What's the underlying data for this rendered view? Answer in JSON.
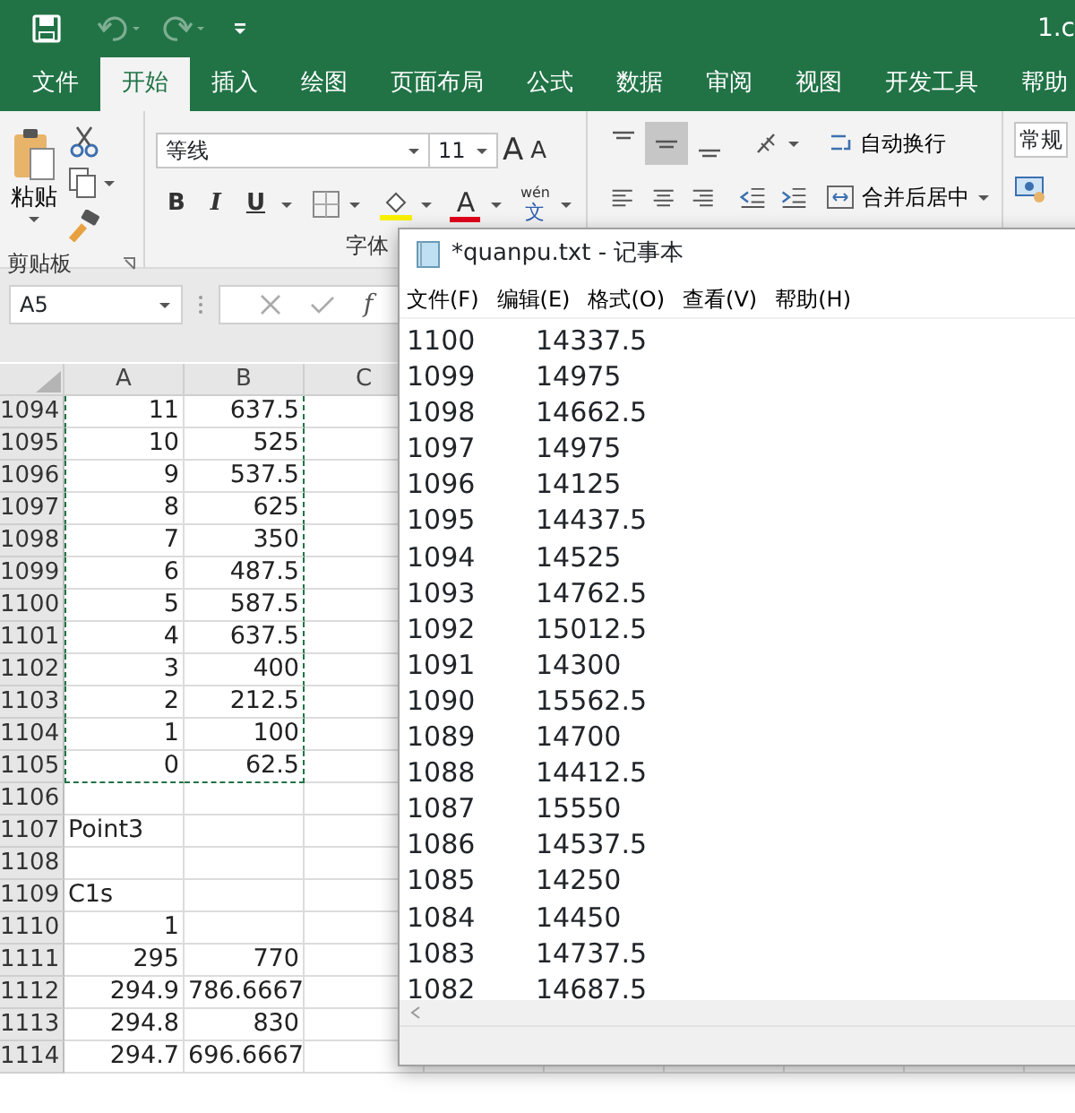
{
  "title_bar": {
    "file_title": "1.c"
  },
  "ribbon_tabs": [
    {
      "label": "文件",
      "selected": false
    },
    {
      "label": "开始",
      "selected": true
    },
    {
      "label": "插入",
      "selected": false
    },
    {
      "label": "绘图",
      "selected": false
    },
    {
      "label": "页面布局",
      "selected": false
    },
    {
      "label": "公式",
      "selected": false
    },
    {
      "label": "数据",
      "selected": false
    },
    {
      "label": "审阅",
      "selected": false
    },
    {
      "label": "视图",
      "selected": false
    },
    {
      "label": "开发工具",
      "selected": false
    },
    {
      "label": "帮助",
      "selected": false
    }
  ],
  "clipboard_group": {
    "paste_label": "粘贴",
    "group_label": "剪贴板"
  },
  "font_group": {
    "font_name": "等线",
    "font_size": "11",
    "grow_font": "A",
    "shrink_font": "A",
    "bold": "B",
    "italic": "I",
    "underline": "U",
    "font_color": "A",
    "phonetic_top": "wén",
    "phonetic_bottom": "文",
    "group_label": "字体"
  },
  "alignment_group": {
    "vertical_align": [
      {
        "kind": "top",
        "selected": false
      },
      {
        "kind": "middle",
        "selected": true
      },
      {
        "kind": "bottom",
        "selected": false
      }
    ],
    "wrap_text": "自动换行",
    "merge_center": "合并后居中"
  },
  "number_group": {
    "format": "常规"
  },
  "formula_bar": {
    "name_box": "A5",
    "fx_label": "f"
  },
  "sheet": {
    "columns": [
      "A",
      "B",
      "C"
    ],
    "rows": [
      {
        "row": "1094",
        "copied": true,
        "cells": [
          {
            "text": "11",
            "kind": "number"
          },
          {
            "text": "637.5",
            "kind": "number"
          }
        ]
      },
      {
        "row": "1095",
        "copied": true,
        "cells": [
          {
            "text": "10",
            "kind": "number"
          },
          {
            "text": "525",
            "kind": "number"
          }
        ]
      },
      {
        "row": "1096",
        "copied": true,
        "cells": [
          {
            "text": "9",
            "kind": "number"
          },
          {
            "text": "537.5",
            "kind": "number"
          }
        ]
      },
      {
        "row": "1097",
        "copied": true,
        "cells": [
          {
            "text": "8",
            "kind": "number"
          },
          {
            "text": "625",
            "kind": "number"
          }
        ]
      },
      {
        "row": "1098",
        "copied": true,
        "cells": [
          {
            "text": "7",
            "kind": "number"
          },
          {
            "text": "350",
            "kind": "number"
          }
        ]
      },
      {
        "row": "1099",
        "copied": true,
        "cells": [
          {
            "text": "6",
            "kind": "number"
          },
          {
            "text": "487.5",
            "kind": "number"
          }
        ]
      },
      {
        "row": "1100",
        "copied": true,
        "cells": [
          {
            "text": "5",
            "kind": "number"
          },
          {
            "text": "587.5",
            "kind": "number"
          }
        ]
      },
      {
        "row": "1101",
        "copied": true,
        "cells": [
          {
            "text": "4",
            "kind": "number"
          },
          {
            "text": "637.5",
            "kind": "number"
          }
        ]
      },
      {
        "row": "1102",
        "copied": true,
        "cells": [
          {
            "text": "3",
            "kind": "number"
          },
          {
            "text": "400",
            "kind": "number"
          }
        ]
      },
      {
        "row": "1103",
        "copied": true,
        "cells": [
          {
            "text": "2",
            "kind": "number"
          },
          {
            "text": "212.5",
            "kind": "number"
          }
        ]
      },
      {
        "row": "1104",
        "copied": true,
        "cells": [
          {
            "text": "1",
            "kind": "number"
          },
          {
            "text": "100",
            "kind": "number"
          }
        ]
      },
      {
        "row": "1105",
        "copied": true,
        "cells": [
          {
            "text": "0",
            "kind": "number"
          },
          {
            "text": "62.5",
            "kind": "number"
          }
        ]
      },
      {
        "row": "1106",
        "copied": false,
        "cells": []
      },
      {
        "row": "1107",
        "copied": false,
        "cells": [
          {
            "text": "Point3",
            "kind": "text"
          }
        ]
      },
      {
        "row": "1108",
        "copied": false,
        "cells": []
      },
      {
        "row": "1109",
        "copied": false,
        "cells": [
          {
            "text": "C1s",
            "kind": "text"
          }
        ]
      },
      {
        "row": "1110",
        "copied": false,
        "cells": [
          {
            "text": "1",
            "kind": "number"
          }
        ]
      },
      {
        "row": "1111",
        "copied": false,
        "cells": [
          {
            "text": "295",
            "kind": "number"
          },
          {
            "text": "770",
            "kind": "number"
          }
        ]
      },
      {
        "row": "1112",
        "copied": false,
        "cells": [
          {
            "text": "294.9",
            "kind": "number"
          },
          {
            "text": "786.6667",
            "kind": "number"
          }
        ]
      },
      {
        "row": "1113",
        "copied": false,
        "cells": [
          {
            "text": "294.8",
            "kind": "number"
          },
          {
            "text": "830",
            "kind": "number"
          }
        ]
      },
      {
        "row": "1114",
        "copied": false,
        "cells": [
          {
            "text": "294.7",
            "kind": "number"
          },
          {
            "text": "696.6667",
            "kind": "number"
          }
        ]
      }
    ]
  },
  "notepad": {
    "title": "*quanpu.txt - 记事本",
    "menu": [
      "文件(F)",
      "编辑(E)",
      "格式(O)",
      "查看(V)",
      "帮助(H)"
    ],
    "lines": [
      {
        "col_1": "1100",
        "col_2": "14337.5"
      },
      {
        "col_1": "1099",
        "col_2": "14975"
      },
      {
        "col_1": "1098",
        "col_2": "14662.5"
      },
      {
        "col_1": "1097",
        "col_2": "14975"
      },
      {
        "col_1": "1096",
        "col_2": "14125"
      },
      {
        "col_1": "1095",
        "col_2": "14437.5"
      },
      {
        "col_1": "1094",
        "col_2": "14525"
      },
      {
        "col_1": "1093",
        "col_2": "14762.5"
      },
      {
        "col_1": "1092",
        "col_2": "15012.5"
      },
      {
        "col_1": "1091",
        "col_2": "14300"
      },
      {
        "col_1": "1090",
        "col_2": "15562.5"
      },
      {
        "col_1": "1089",
        "col_2": "14700"
      },
      {
        "col_1": "1088",
        "col_2": "14412.5"
      },
      {
        "col_1": "1087",
        "col_2": "15550"
      },
      {
        "col_1": "1086",
        "col_2": "14537.5"
      },
      {
        "col_1": "1085",
        "col_2": "14250"
      },
      {
        "col_1": "1084",
        "col_2": "14450"
      },
      {
        "col_1": "1083",
        "col_2": "14737.5"
      },
      {
        "col_1": "1082",
        "col_2": "14687.5"
      }
    ]
  }
}
